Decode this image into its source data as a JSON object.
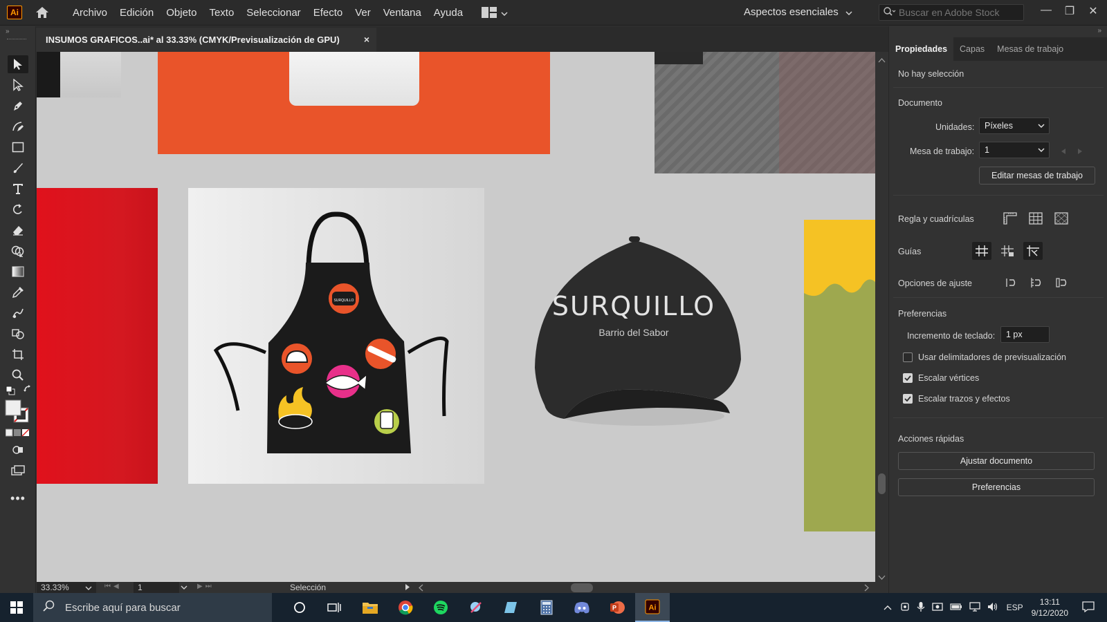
{
  "app": {
    "logo_text": "Ai",
    "menu": [
      "Archivo",
      "Edición",
      "Objeto",
      "Texto",
      "Seleccionar",
      "Efecto",
      "Ver",
      "Ventana",
      "Ayuda"
    ],
    "workspace": "Aspectos esenciales",
    "stock_search_placeholder": "Buscar en Adobe Stock"
  },
  "document": {
    "tab_title": "INSUMOS GRAFICOS..ai* al 33.33% (CMYK/Previsualización de GPU)",
    "close_glyph": "×"
  },
  "artwork": {
    "cap_brand": "SURQUILLO",
    "cap_tagline": "Barrio del Sabor",
    "pot_badge": "SURQUILLO",
    "colors": {
      "orange": "#e9542a",
      "red": "#d9141f",
      "yellow": "#f5c224",
      "olive": "#9ea84f",
      "canvas": "#cbcbcb"
    }
  },
  "statusbar": {
    "zoom": "33.33%",
    "artboard": "1",
    "status": "Selección"
  },
  "panel": {
    "tabs": [
      "Propiedades",
      "Capas",
      "Mesas de trabajo"
    ],
    "no_selection": "No hay selección",
    "document_header": "Documento",
    "units_label": "Unidades:",
    "units_value": "Píxeles",
    "artboard_label": "Mesa de trabajo:",
    "artboard_value": "1",
    "edit_artboards": "Editar mesas de trabajo",
    "rulers_label": "Regla y cuadrículas",
    "guides_label": "Guías",
    "snap_label": "Opciones de ajuste",
    "prefs_header": "Preferencias",
    "keyboard_inc_label": "Incremento de teclado:",
    "keyboard_inc_value": "1 px",
    "check_preview_bounds": "Usar delimitadores de previsualización",
    "check_scale_corners": "Escalar vértices",
    "check_scale_strokes": "Escalar trazos y efectos",
    "quick_actions_header": "Acciones rápidas",
    "fit_document": "Ajustar documento",
    "preferences_button": "Preferencias"
  },
  "taskbar": {
    "search_placeholder": "Escribe aquí para buscar",
    "language": "ESP",
    "time": "13:11",
    "date": "9/12/2020"
  }
}
